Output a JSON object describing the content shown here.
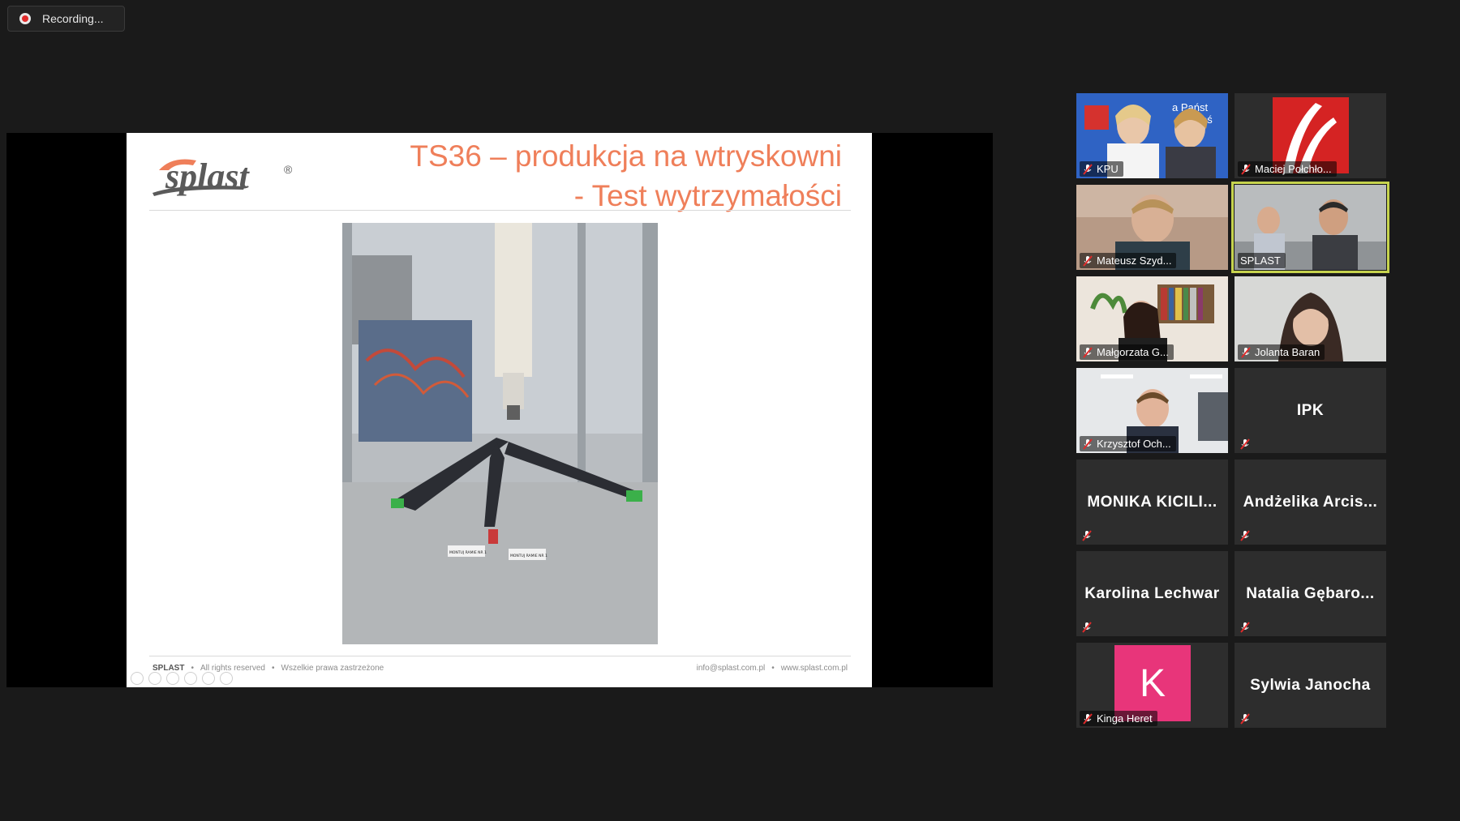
{
  "recording": {
    "label": "Recording..."
  },
  "slide": {
    "title_line1": "TS36 – produkcja na wtryskowni",
    "title_line2": "- Test wytrzymałości",
    "footer_left": [
      "SPLAST",
      "All rights reserved",
      "Wszelkie prawa zastrzeżone"
    ],
    "footer_right": [
      "info@splast.com.pl",
      "www.splast.com.pl"
    ],
    "footer_sep": "•",
    "logo_mark": "®",
    "logo_text": "splast",
    "photo_tag_1": "MONTUJ RAMIE NR 1",
    "photo_tag_2": "MONTUJ RAMIE NR 1"
  },
  "colors": {
    "title": "#ef7f5a",
    "active_speaker": "#c6d34e",
    "avatar_k": "#e8357a",
    "muted": "#e02b2b"
  },
  "participants": [
    {
      "name": "KPU",
      "video": true,
      "muted": true
    },
    {
      "name": "Maciej Połchło...",
      "video": true,
      "muted": true
    },
    {
      "name": "Mateusz Szyd...",
      "video": true,
      "muted": true
    },
    {
      "name": "SPLAST",
      "video": true,
      "muted": false,
      "active": true
    },
    {
      "name": "Małgorzata G...",
      "video": true,
      "muted": true
    },
    {
      "name": "Jolanta Baran",
      "video": true,
      "muted": true
    },
    {
      "name": "Krzysztof Och...",
      "video": true,
      "muted": true
    },
    {
      "name": "IPK",
      "video": false,
      "muted": true
    },
    {
      "name": "MONIKA KICILI...",
      "video": false,
      "muted": true
    },
    {
      "name": "Andżelika Arcis...",
      "video": false,
      "muted": true
    },
    {
      "name": "Karolina Lechwar",
      "video": false,
      "muted": true
    },
    {
      "name": "Natalia Gębaro...",
      "video": false,
      "muted": true
    },
    {
      "name": "Kinga Heret",
      "video": false,
      "avatar": "K",
      "muted": true
    },
    {
      "name": "Sylwia Janocha",
      "video": false,
      "muted": true
    }
  ],
  "tile_text": {
    "kpu_backdrop_1": "a Państ",
    "kpu_backdrop_2": "w Kroś"
  }
}
